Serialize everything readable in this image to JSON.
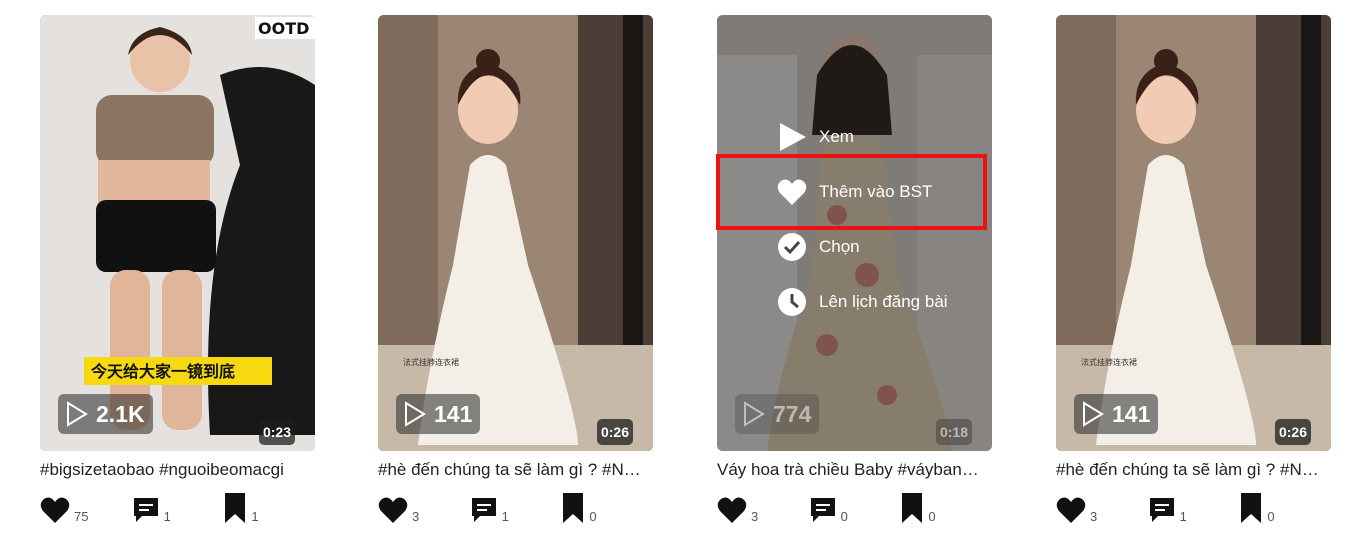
{
  "cards": [
    {
      "views": "2.1K",
      "duration": "0:23",
      "caption": "#bigsizetaobao #nguoibeomacgi",
      "likes": "75",
      "comments": "1",
      "saves": "1",
      "overlay_text_1": "OOTD",
      "overlay_text_2": "今天给大家一镜到底"
    },
    {
      "views": "141",
      "duration": "0:26",
      "caption": "#hè đến chúng ta sẽ làm gì ? #N…",
      "likes": "3",
      "comments": "1",
      "saves": "0",
      "overlay_text_1": "法式挂脖连衣裙"
    },
    {
      "views": "774",
      "duration": "0:18",
      "caption": "Váy hoa trà chiều Baby #váyban…",
      "likes": "3",
      "comments": "0",
      "saves": "0"
    },
    {
      "views": "141",
      "duration": "0:26",
      "caption": "#hè đến chúng ta sẽ làm gì ? #N…",
      "likes": "3",
      "comments": "1",
      "saves": "0",
      "overlay_text_1": "法式挂脖连衣裙"
    }
  ],
  "menu": {
    "view": "Xem",
    "add_to_collection": "Thêm vào BST",
    "select": "Chọn",
    "schedule": "Lên lịch đăng bài"
  },
  "colors": {
    "highlight": "#ee1111",
    "overlay": "#141414"
  },
  "icons": [
    "play-icon",
    "heart-icon",
    "comment-icon",
    "bookmark-icon",
    "check-icon",
    "clock-icon"
  ]
}
